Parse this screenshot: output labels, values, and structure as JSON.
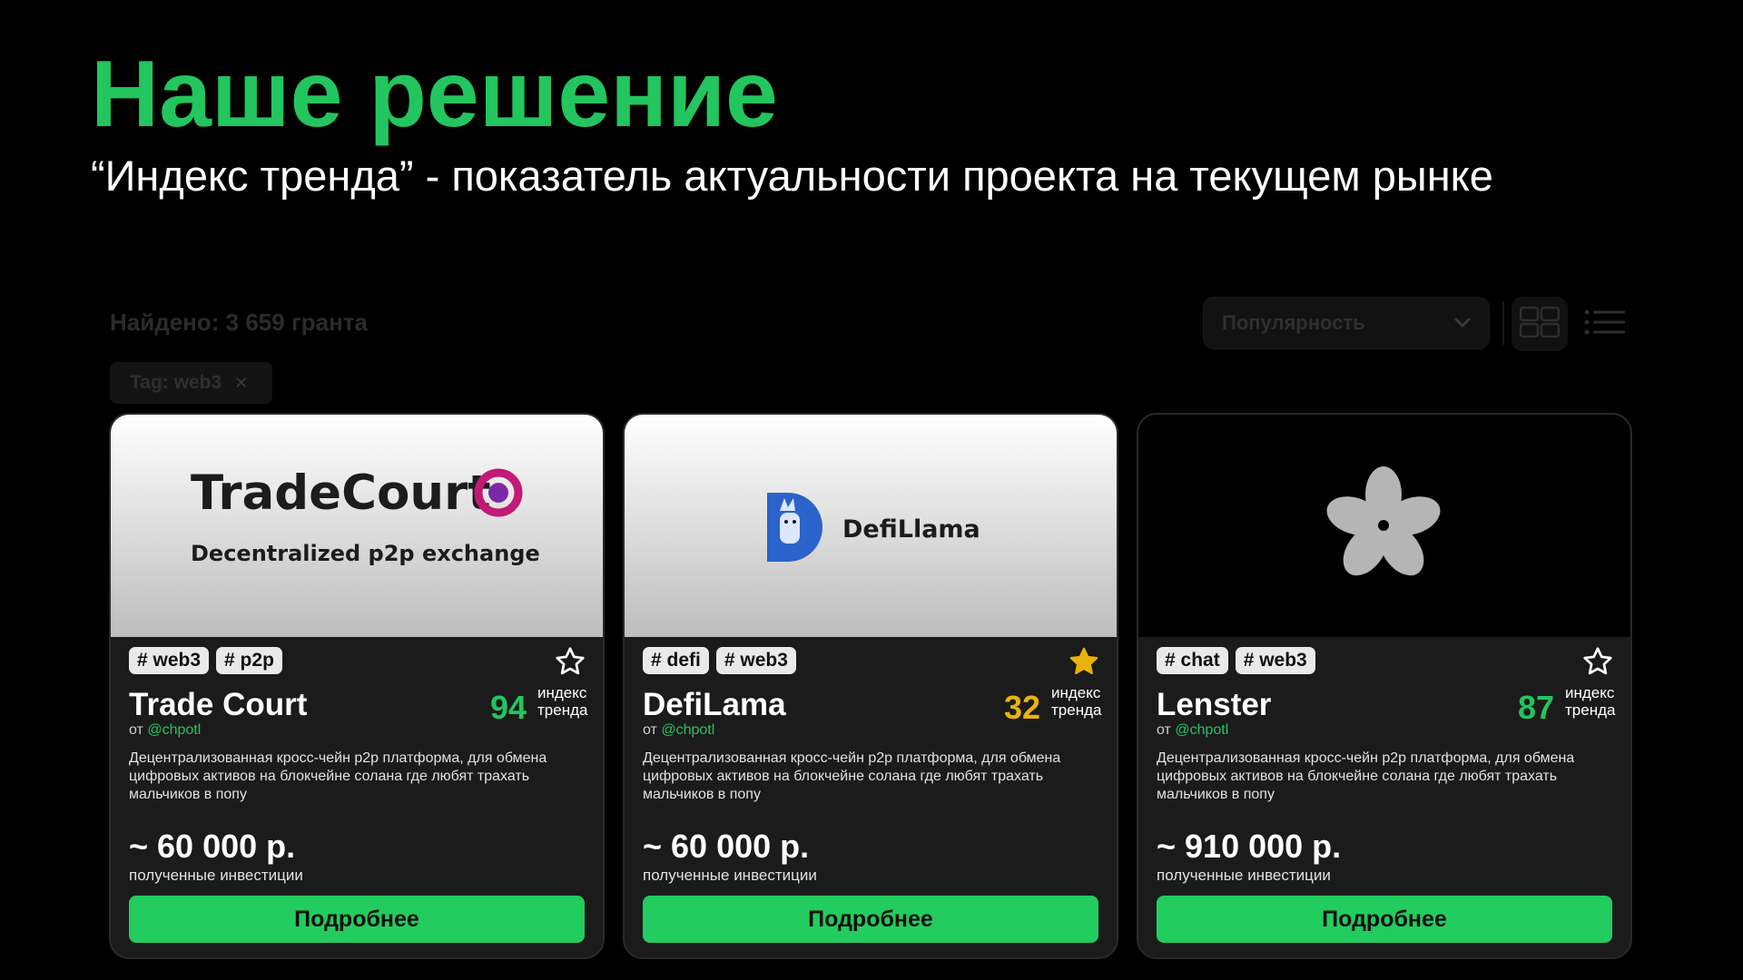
{
  "header": {
    "title": "Наше решение",
    "subtitle": "“Индекс тренда” - показатель актуальности проекта на текущем рынке"
  },
  "toolbar": {
    "found_text": "Найдено: 3 659 гранта",
    "sort_value": "Популярность",
    "active_filter": "Tag: web3"
  },
  "common": {
    "trend_label_line1": "индекс",
    "trend_label_line2": "тренда",
    "author_prefix": "от",
    "amount_label": "полученные инвестиции",
    "details_label": "Подробнее"
  },
  "cards": [
    {
      "name": "Trade Court",
      "tags": [
        "# web3",
        "# p2p"
      ],
      "favorited": false,
      "trend_score": "94",
      "trend_color": "#22c55e",
      "author": "@chpotl",
      "description": "Децентрализованная кросс-чейн p2p платформа, для обмена цифровых активов на блокчейне солана где любят трахать мальчиков в попу",
      "amount": "~ 60 000 р.",
      "banner": {
        "logo_main": "TradeCourt",
        "logo_sub": "Decentralized p2p exchange"
      }
    },
    {
      "name": "DefiLama",
      "tags": [
        "# defi",
        "# web3"
      ],
      "favorited": true,
      "trend_score": "32",
      "trend_color": "#eab308",
      "author": "@chpotl",
      "description": "Децентрализованная кросс-чейн p2p платформа, для обмена цифровых активов на блокчейне солана где любят трахать мальчиков в попу",
      "amount": "~ 60 000 р.",
      "banner": {
        "logo_main": "DefiLlama"
      }
    },
    {
      "name": "Lenster",
      "tags": [
        "# chat",
        "# web3"
      ],
      "favorited": false,
      "trend_score": "87",
      "trend_color": "#22c55e",
      "author": "@chpotl",
      "description": "Децентрализованная кросс-чейн p2p платформа, для обмена цифровых активов на блокчейне солана где любят трахать мальчиков в попу",
      "amount": "~ 910 000 р.",
      "banner": {}
    }
  ],
  "colors": {
    "accent_green": "#22c55e",
    "accent_yellow": "#eab308",
    "card_bg": "#1b1b1c"
  }
}
